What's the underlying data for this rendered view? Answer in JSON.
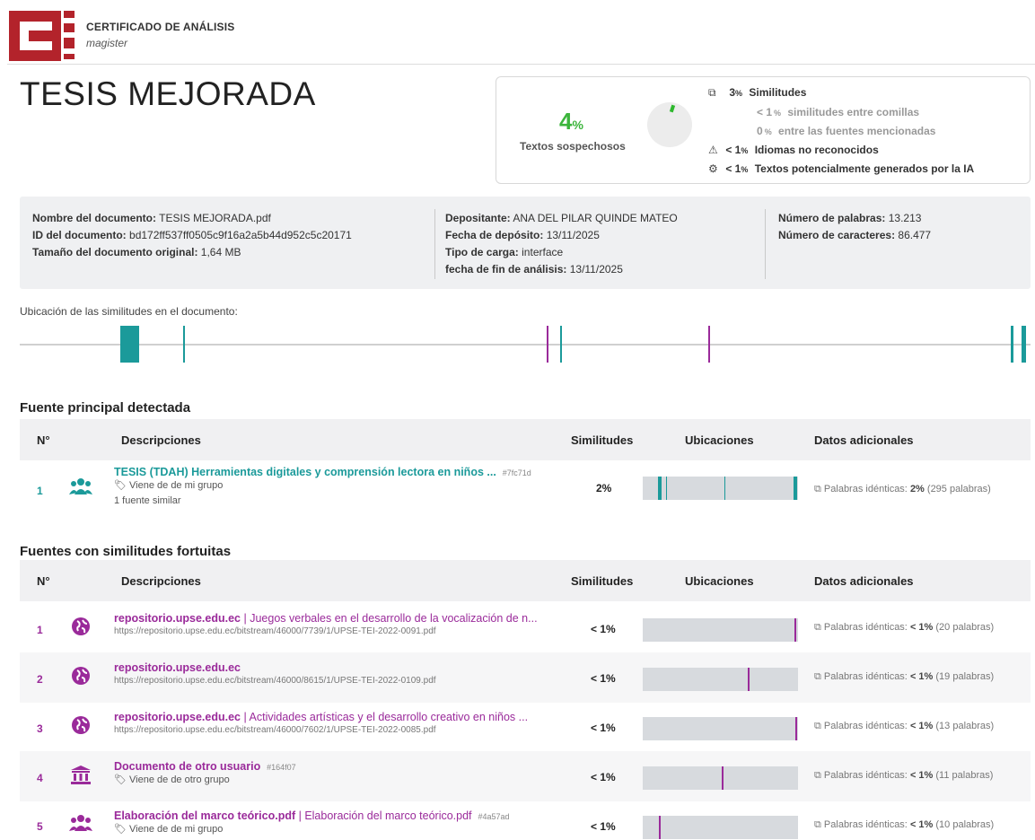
{
  "header": {
    "title": "CERTIFICADO DE ANÁLISIS",
    "subtitle": "magister"
  },
  "document_title": "TESIS MEJORADA",
  "summary": {
    "pct_value": "4",
    "pct_unit": "%",
    "pct_label": "Textos sospechosos",
    "similitudes": {
      "value": "3",
      "unit": "%",
      "label": "Similitudes"
    },
    "comillas": {
      "value": "< 1",
      "unit": "%",
      "label": "similitudes entre comillas"
    },
    "fuentes": {
      "value": "0",
      "unit": "%",
      "label": "entre las fuentes mencionadas"
    },
    "idiomas": {
      "value": "< 1",
      "unit": "%",
      "label": "Idiomas no reconocidos"
    },
    "ia": {
      "value": "< 1",
      "unit": "%",
      "label": "Textos potencialmente generados por la IA"
    },
    "accent_color": "#3cb53c"
  },
  "info": {
    "nombre_label": "Nombre del documento:",
    "nombre": "TESIS MEJORADA.pdf",
    "id_label": "ID del documento:",
    "id": "bd172ff537ff0505c9f16a2a5b44d952c5c20171",
    "tamano_label": "Tamaño del documento original:",
    "tamano": "1,64 MB",
    "depositante_label": "Depositante:",
    "depositante": "ANA DEL PILAR QUINDE MATEO",
    "fecha_dep_label": "Fecha de depósito:",
    "fecha_dep": "13/11/2025",
    "tipo_label": "Tipo de carga:",
    "tipo": "interface",
    "fecha_fin_label": "fecha de fin de análisis:",
    "fecha_fin": "13/11/2025",
    "palabras_label": "Número de palabras:",
    "palabras": "13.213",
    "caracteres_label": "Número de caracteres:",
    "caracteres": "86.477"
  },
  "ubicacion_label": "Ubicación de las similitudes en el documento:",
  "colors": {
    "teal": "#1b9a9a",
    "magenta": "#9a2a9a"
  },
  "principal": {
    "title": "Fuente principal detectada",
    "headers": {
      "num": "N°",
      "desc": "Descripciones",
      "sim": "Similitudes",
      "ubic": "Ubicaciones",
      "datos": "Datos adicionales"
    },
    "row": {
      "num": "1",
      "title": "TESIS (TDAH) Herramientas digitales y comprensión lectora en niños ...",
      "hash": "#7fc71d",
      "sub": "Viene de de mi grupo",
      "similar": "1 fuente similar",
      "sim": "2%",
      "datos_label": "Palabras idénticas:",
      "datos_pct": "2%",
      "datos_words": "(295 palabras)"
    }
  },
  "fortuitas": {
    "title": "Fuentes con similitudes fortuitas",
    "headers": {
      "num": "N°",
      "desc": "Descripciones",
      "sim": "Similitudes",
      "ubic": "Ubicaciones",
      "datos": "Datos adicionales"
    },
    "rows": [
      {
        "num": "1",
        "source": "repositorio.upse.edu.ec",
        "rest": " | Juegos verbales en el desarrollo de la vocalización de n...",
        "url": "https://repositorio.upse.edu.ec/bitstream/46000/7739/1/UPSE-TEI-2022-0091.pdf",
        "sim": "< 1%",
        "datos_label": "Palabras idénticas:",
        "datos_pct": "< 1%",
        "datos_words": "(20 palabras)"
      },
      {
        "num": "2",
        "source": "repositorio.upse.edu.ec",
        "rest": "",
        "url": "https://repositorio.upse.edu.ec/bitstream/46000/8615/1/UPSE-TEI-2022-0109.pdf",
        "sim": "< 1%",
        "datos_label": "Palabras idénticas:",
        "datos_pct": "< 1%",
        "datos_words": "(19 palabras)"
      },
      {
        "num": "3",
        "source": "repositorio.upse.edu.ec",
        "rest": " | Actividades artísticas y el desarrollo creativo en niños ...",
        "url": "https://repositorio.upse.edu.ec/bitstream/46000/7602/1/UPSE-TEI-2022-0085.pdf",
        "sim": "< 1%",
        "datos_label": "Palabras idénticas:",
        "datos_pct": "< 1%",
        "datos_words": "(13 palabras)"
      },
      {
        "num": "4",
        "source": "Documento de otro usuario",
        "hash": "#164f07",
        "sub": "Viene de de otro grupo",
        "sim": "< 1%",
        "datos_label": "Palabras idénticas:",
        "datos_pct": "< 1%",
        "datos_words": "(11 palabras)"
      },
      {
        "num": "5",
        "source": "Elaboración del marco teórico.pdf",
        "rest": " | Elaboración del marco teórico.pdf",
        "hash": "#4a57ad",
        "sub": "Viene de de mi grupo",
        "sim": "< 1%",
        "datos_label": "Palabras idénticas:",
        "datos_pct": "< 1%",
        "datos_words": "(10 palabras)"
      }
    ]
  }
}
